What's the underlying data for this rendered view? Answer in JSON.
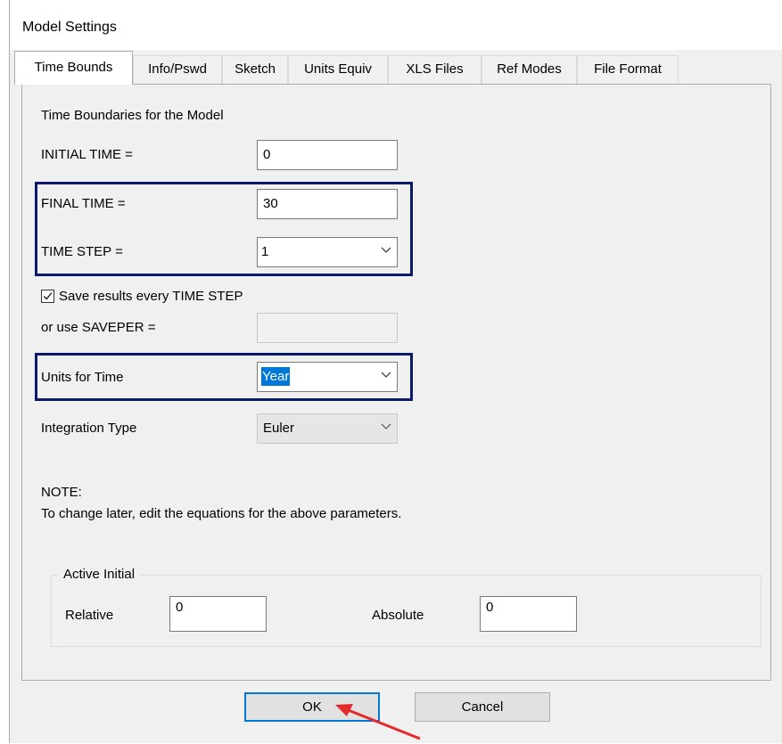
{
  "window": {
    "title": "Model Settings"
  },
  "tabs": [
    {
      "label": "Time Bounds",
      "active": true
    },
    {
      "label": "Info/Pswd"
    },
    {
      "label": "Sketch"
    },
    {
      "label": "Units Equiv"
    },
    {
      "label": "XLS Files"
    },
    {
      "label": "Ref Modes"
    },
    {
      "label": "File Format"
    }
  ],
  "time_bounds": {
    "heading": "Time Boundaries for the Model",
    "initial_time": {
      "label": "INITIAL TIME =",
      "value": "0"
    },
    "final_time": {
      "label": "FINAL TIME =",
      "value": "30"
    },
    "time_step": {
      "label": "TIME STEP =",
      "value": "1"
    },
    "save_every": {
      "label": "Save results every TIME STEP",
      "checked": true
    },
    "saveper": {
      "label": "or use SAVEPER =",
      "value": ""
    },
    "units_for_time": {
      "label": "Units for Time",
      "value": "Year"
    },
    "integration_type": {
      "label": "Integration Type",
      "value": "Euler"
    },
    "note_title": "NOTE:",
    "note_text": "To change later, edit the equations for the above parameters."
  },
  "active_initial": {
    "title": "Active Initial",
    "relative": {
      "label": "Relative",
      "value": "0"
    },
    "absolute": {
      "label": "Absolute",
      "value": "0"
    }
  },
  "buttons": {
    "ok": "OK",
    "cancel": "Cancel"
  },
  "colors": {
    "highlight_box": "#0b1a6b",
    "annotation_arrow": "#e32b2b",
    "selection": "#0078d7"
  }
}
